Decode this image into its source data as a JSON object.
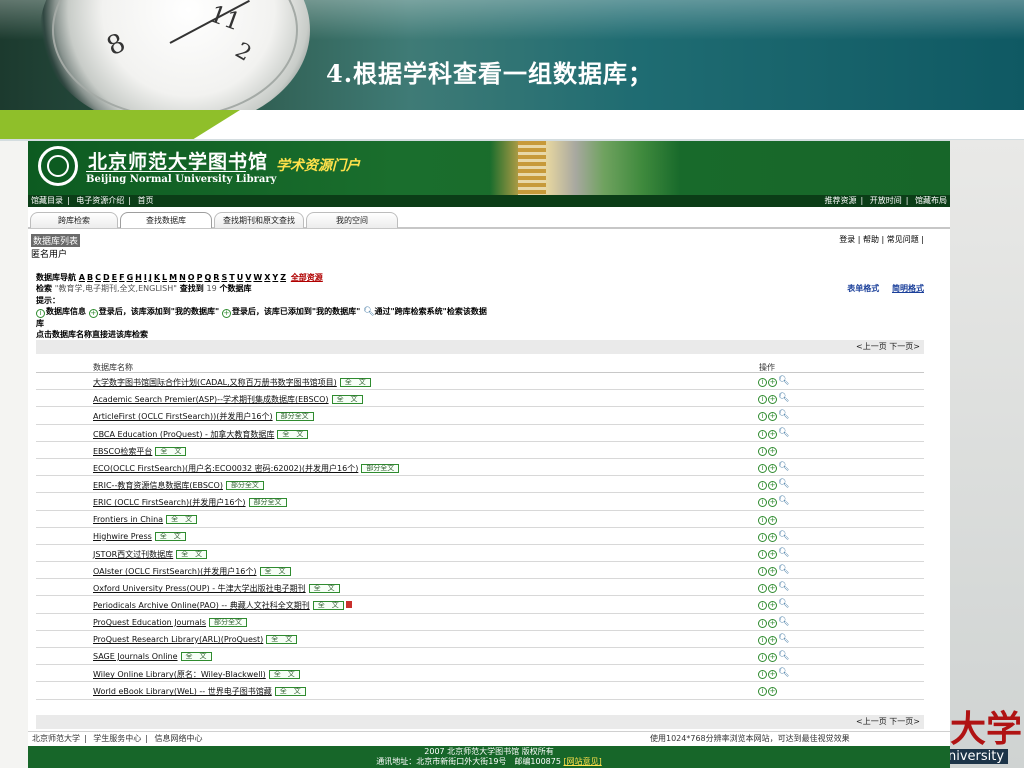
{
  "slide": {
    "title": "4.根据学科查看一组数据库；",
    "deco_text": "大学",
    "deco_en": "niversity"
  },
  "watch": {
    "num_a": "8",
    "num_b": "11",
    "num_c": "2"
  },
  "banner": {
    "cn_name": "北京师范大学图书馆",
    "en_name": "Beijing Normal University Library",
    "portal": "学术资源门户"
  },
  "topnav": {
    "left": [
      "馆藏目录",
      "电子资源介绍",
      "首页"
    ],
    "right": [
      "推荐资源",
      "开放时间",
      "馆藏布局"
    ]
  },
  "tabs": [
    "跨库检索",
    "查找数据库",
    "查找期刊和原文查找",
    "我的空间"
  ],
  "header": {
    "list_label": "数据库列表",
    "user_label": "匿名用户",
    "util_links": "登录 | 帮助 | 常见问题 |"
  },
  "nav": {
    "label": "数据库导航",
    "letters": [
      "A",
      "B",
      "C",
      "D",
      "E",
      "F",
      "G",
      "H",
      "I",
      "J",
      "K",
      "L",
      "M",
      "N",
      "O",
      "P",
      "Q",
      "R",
      "S",
      "T",
      "U",
      "V",
      "W",
      "X",
      "Y",
      "Z"
    ],
    "all": "全部资源"
  },
  "search": {
    "prefix": "检索",
    "query": "\"教育学,电子期刊,全文,ENGLISH\"",
    "found": "查找到",
    "count": "19",
    "suffix": "个数据库"
  },
  "formats": {
    "table": "表单格式",
    "brief": "简明格式"
  },
  "hints": {
    "label": "提示：",
    "info": "数据库信息",
    "add": "登录后，该库添加到\"我的数据库\"",
    "added": "登录后，该库已添加到\"我的数据库\"",
    "search": "通过\"跨库检索系统\"检索该数据",
    "ku": "库",
    "click": "点击数据库名称直接进该库检索"
  },
  "pager": {
    "prev": "<上一页",
    "next": "下一页>"
  },
  "table": {
    "col_name": "数据库名称",
    "col_ops": "操作",
    "rows": [
      {
        "name": "大学数字图书馆国际合作计划(CADAL,又称百万册书数字图书馆项目)",
        "badge": "全　文",
        "ops": "i+s"
      },
      {
        "name": "Academic Search Premier(ASP)--学术期刊集成数据库(EBSCO)",
        "badge": "全　文",
        "ops": "i+s"
      },
      {
        "name": "ArticleFirst (OCLC FirstSearch))(并发用户16个)",
        "badge": "部分全文",
        "ops": "i+s"
      },
      {
        "name": "CBCA Education (ProQuest) - 加拿大教育数据库",
        "badge": "全　文",
        "ops": "i+s"
      },
      {
        "name": "EBSCO检索平台",
        "badge": "全　文",
        "ops": "i+"
      },
      {
        "name": "ECO(OCLC FirstSearch)(用户名:ECO0032 密码:62002)(并发用户16个)",
        "badge": "部分全文",
        "ops": "i+s"
      },
      {
        "name": "ERIC--教育资源信息数据库(EBSCO)",
        "badge": "部分全文",
        "ops": "i+s"
      },
      {
        "name": "ERIC (OCLC FirstSearch)(并发用户16个)",
        "badge": "部分全文",
        "ops": "i+s"
      },
      {
        "name": "Frontiers in China",
        "badge": "全　文",
        "ops": "i+"
      },
      {
        "name": "Highwire Press",
        "badge": "全　文",
        "ops": "i+s"
      },
      {
        "name": "JSTOR西文过刊数据库",
        "badge": "全　文",
        "ops": "i+s"
      },
      {
        "name": "OAIster (OCLC FirstSearch)(并发用户16个)",
        "badge": "全　文",
        "ops": "i+s"
      },
      {
        "name": "Oxford University Press(OUP) - 牛津大学出版社电子期刊",
        "badge": "全　文",
        "ops": "i+s"
      },
      {
        "name": "Periodicals Archive Online(PAO) -- 典藏人文社科全文期刊",
        "badge": "全　文",
        "ops": "i+s",
        "pdf": true
      },
      {
        "name": "ProQuest Education Journals",
        "badge": "部分全文",
        "ops": "i+s"
      },
      {
        "name": "ProQuest Research Library(ARL)(ProQuest)",
        "badge": "全　文",
        "ops": "i+s"
      },
      {
        "name": "SAGE Journals Online",
        "badge": "全　文",
        "ops": "i+s"
      },
      {
        "name": "Wiley Online Library(原名：Wiley-Blackwell)",
        "badge": "全　文",
        "ops": "i+s"
      },
      {
        "name": "World eBook Library(WeL) -- 世界电子图书馆藏",
        "badge": "全　文",
        "ops": "i+"
      }
    ]
  },
  "footer": {
    "links": [
      "北京师范大学",
      "学生服务中心",
      "信息网络中心"
    ],
    "browser_note": "使用1024*768分辨率浏览本网站，可达到最佳视觉效果",
    "copyright": "2007 北京师范大学图书馆 版权所有",
    "address": "通讯地址：北京市新街口外大街19号　邮编100875",
    "feedback": "[网站意见]"
  },
  "colors": {
    "banner": "#176629",
    "accent": "#8fbf2a",
    "link_blue": "#1a3f9a",
    "all_red": "#b00000"
  }
}
